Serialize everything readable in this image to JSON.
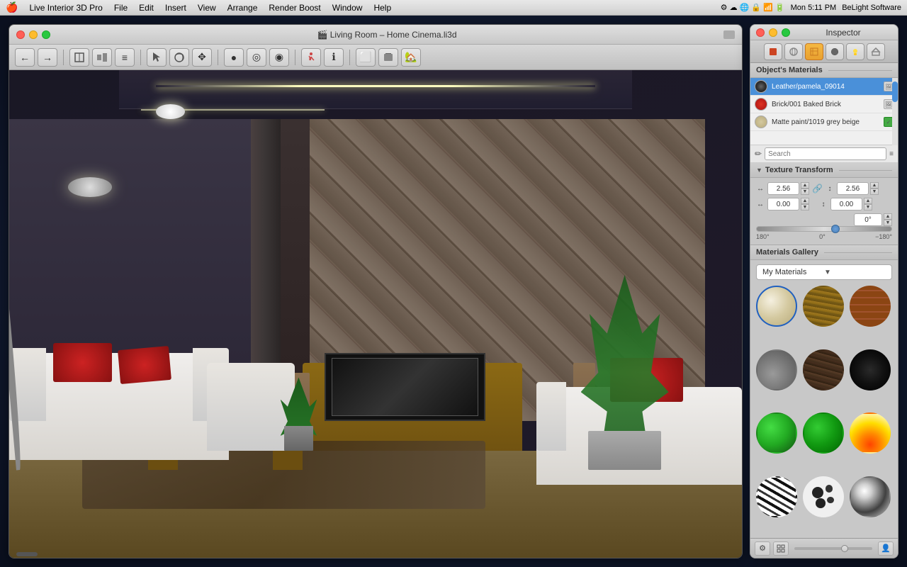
{
  "menubar": {
    "apple": "🍎",
    "items": [
      "Live Interior 3D Pro",
      "File",
      "Edit",
      "Insert",
      "View",
      "Arrange",
      "Render Boost",
      "Window",
      "Help"
    ],
    "right": {
      "time": "Mon 5:11 PM",
      "brand": "BeLight Software"
    }
  },
  "main_window": {
    "title": "🎬 Living Room – Home Cinema.li3d",
    "traffic_lights": {
      "close": "close",
      "minimize": "minimize",
      "maximize": "maximize"
    }
  },
  "toolbar": {
    "nav_back": "←",
    "nav_forward": "→",
    "btn_floor_plan": "□",
    "btn_view3d": "🏠",
    "btn_mode": "≡",
    "btn_select": "↖",
    "btn_orbit": "↻",
    "btn_move": "✥",
    "btn_dot1": "●",
    "btn_dot2": "◎",
    "btn_dot3": "◉",
    "btn_camera1": "📷",
    "btn_camera2": "📸",
    "btn_info": "ℹ",
    "btn_aspect": "⬜",
    "btn_house": "🏠",
    "btn_3d": "🏡"
  },
  "inspector": {
    "title": "Inspector",
    "tabs": [
      {
        "id": "home",
        "icon": "🏠",
        "active": false
      },
      {
        "id": "sphere",
        "icon": "●",
        "active": false
      },
      {
        "id": "paint",
        "icon": "🎨",
        "active": true
      },
      {
        "id": "material",
        "icon": "💿",
        "active": false
      },
      {
        "id": "light",
        "icon": "💡",
        "active": false
      },
      {
        "id": "house2",
        "icon": "🏡",
        "active": false
      }
    ],
    "objects_materials_label": "Object's Materials",
    "materials_list": [
      {
        "id": 1,
        "name": "Leather/pamela_09014",
        "swatch_color": "#555555",
        "selected": true
      },
      {
        "id": 2,
        "name": "Brick/001 Baked Brick",
        "swatch_color": "#cc3322",
        "selected": false
      },
      {
        "id": 3,
        "name": "Matte paint/1019 grey beige",
        "swatch_color": "#d4c9a0",
        "selected": false
      }
    ],
    "search_placeholder": "Search",
    "texture_transform_label": "Texture Transform",
    "transform": {
      "width_label": "W",
      "height_label": "H",
      "offset_x_label": "↔",
      "offset_y_label": "↕",
      "width_value": "2.56",
      "height_value": "2.56",
      "offset_x_value": "0.00",
      "offset_y_value": "0.00",
      "rotation_value": "0°",
      "rotation_min": "180°",
      "rotation_mid": "0°",
      "rotation_max": "−180°"
    },
    "gallery_label": "Materials Gallery",
    "gallery_dropdown": "My Materials",
    "gallery_items": [
      {
        "id": 1,
        "css_class": "mat-cream",
        "name": "Cream fabric"
      },
      {
        "id": 2,
        "css_class": "mat-wood-light",
        "name": "Light wood"
      },
      {
        "id": 3,
        "css_class": "mat-brick",
        "name": "Brick"
      },
      {
        "id": 4,
        "css_class": "mat-concrete",
        "name": "Concrete"
      },
      {
        "id": 5,
        "css_class": "mat-dark-wood",
        "name": "Dark wood"
      },
      {
        "id": 6,
        "css_class": "mat-very-dark",
        "name": "Very dark"
      },
      {
        "id": 7,
        "css_class": "mat-green-bright",
        "name": "Bright green"
      },
      {
        "id": 8,
        "css_class": "mat-green-dark",
        "name": "Dark green"
      },
      {
        "id": 9,
        "css_class": "mat-fire",
        "name": "Fire"
      },
      {
        "id": 10,
        "css_class": "mat-zebra",
        "name": "Zebra"
      },
      {
        "id": 11,
        "css_class": "mat-spots",
        "name": "Spots"
      },
      {
        "id": 12,
        "css_class": "mat-chrome",
        "name": "Chrome"
      }
    ]
  }
}
